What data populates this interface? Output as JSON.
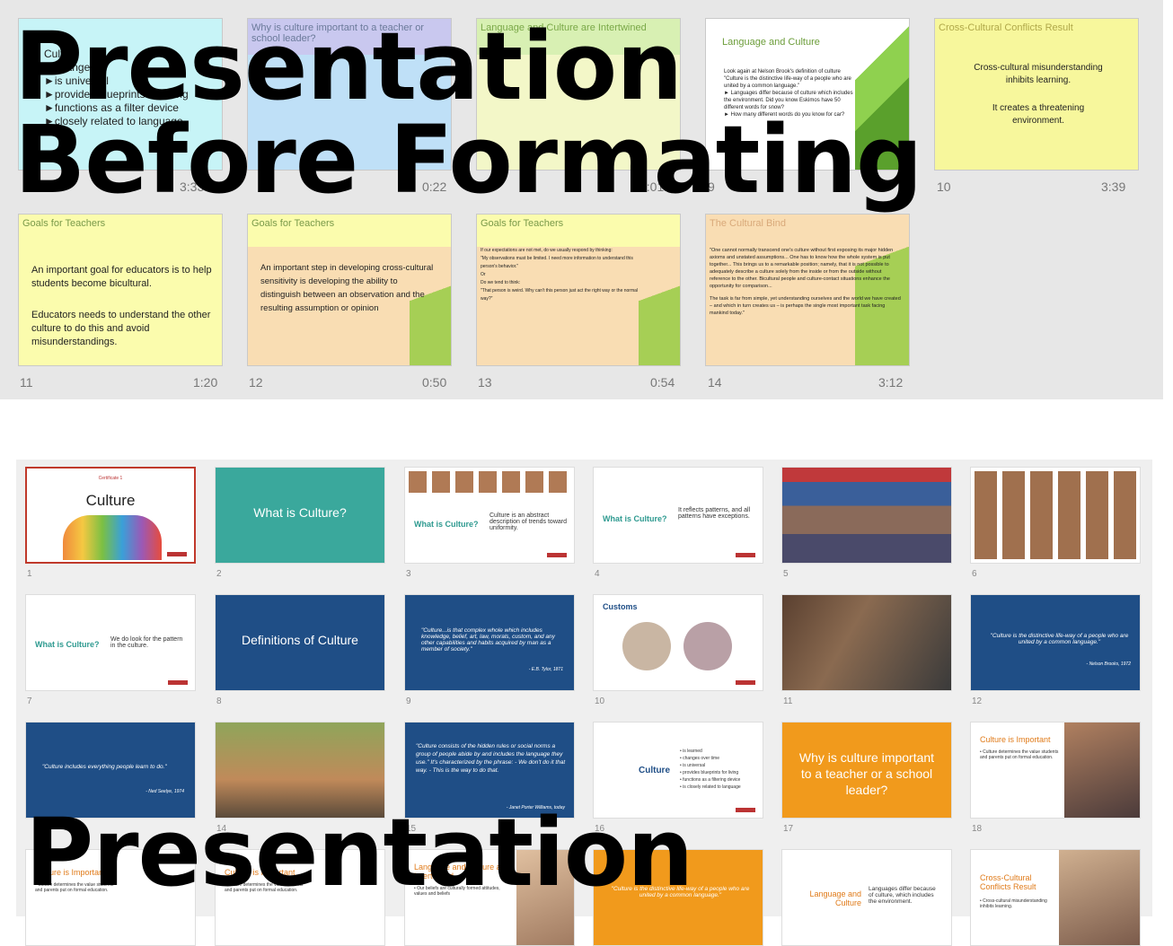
{
  "overlay": {
    "top_line1": "Presentation",
    "top_line2": "Before Formating",
    "bottom_line1": "Presentation"
  },
  "old_slides": [
    {
      "num": "",
      "time": "",
      "title": "",
      "lines": [
        "Culture",
        "►change",
        "►is universal",
        "►provides blueprints for living",
        "►functions as a filter device",
        "►closely related to language"
      ],
      "meta": "3:33"
    },
    {
      "num": "",
      "time": "",
      "title": "Why is culture important to a teacher or school leader?",
      "lines": [],
      "meta": "0:22"
    },
    {
      "num": "8",
      "time": "",
      "title": "Language and Culture are Intertwined",
      "lines": [],
      "meta": "0:01"
    },
    {
      "num": "9",
      "time": "",
      "title": "Language and Culture",
      "lines": [
        "Look again at Nelson Brook's definition of culture",
        "\"Culture is the distinctive life-way of a people who are united by a common language.\"",
        "► Languages differ because of culture which includes the environment. Did you know Eskimos have 50 different words for snow?",
        "► How many different words do you know for car?"
      ],
      "meta": ""
    },
    {
      "num": "10",
      "time": "3:39",
      "title": "Cross-Cultural Conflicts Result",
      "lines": [
        "Cross-cultural misunderstanding inhibits learning.",
        "It creates a threatening environment."
      ],
      "meta": ""
    },
    {
      "num": "11",
      "time": "1:20",
      "title": "Goals for Teachers",
      "lines": [
        "An important goal for educators is to help students become bicultural.",
        "Educators needs to understand the other culture to do this and avoid misunderstandings."
      ],
      "meta": ""
    },
    {
      "num": "12",
      "time": "0:50",
      "title": "Goals for Teachers",
      "lines": [
        "An important step in developing cross-cultural sensitivity is developing the ability to distinguish between an observation and the resulting assumption or opinion"
      ],
      "meta": ""
    },
    {
      "num": "13",
      "time": "0:54",
      "title": "Goals for Teachers",
      "lines": [
        "If our expectations are not met, do we usually respond by thinking:",
        "\"My observations must be limited. I need more information to understand this person's behavior.\"",
        "Or",
        "Do we tend to think:",
        "\"That person is weird. Why can't this person just act the right way or the normal way?\""
      ],
      "meta": ""
    },
    {
      "num": "14",
      "time": "3:12",
      "title": "The Cultural Bind",
      "lines": [
        "\"One cannot normally transcend one's culture without first exposing its major hidden axioms and unstated assumptions... One has to know how the whole system is put together... This brings us to a remarkable position; namely, that it is not possible to adequately describe a culture solely from the inside or from the outside without reference to the other. Bicultural people and culture-contact situations enhance the opportunity for comparison...",
        "The task is far from simple, yet understanding ourselves and the world we have created – and which in turn creates us – is perhaps the single most important task facing mankind today.\""
      ],
      "meta": ""
    }
  ],
  "new_slides": [
    {
      "num": "1",
      "title": "Culture",
      "sub": "Certificate 1",
      "kind": "hands"
    },
    {
      "num": "2",
      "title": "What is Culture?",
      "kind": "teal"
    },
    {
      "num": "3",
      "title": "What is Culture?",
      "body": "Culture is an abstract description of trends toward uniformity.",
      "kind": "white-faces"
    },
    {
      "num": "4",
      "title": "What is Culture?",
      "body": "It reflects patterns, and all patterns have exceptions.",
      "kind": "white"
    },
    {
      "num": "5",
      "title": "",
      "kind": "crowd"
    },
    {
      "num": "6",
      "title": "",
      "kind": "faces"
    },
    {
      "num": "7",
      "title": "What is Culture?",
      "body": "We do look for the pattern in the culture.",
      "kind": "white"
    },
    {
      "num": "8",
      "title": "Definitions of Culture",
      "kind": "navy"
    },
    {
      "num": "9",
      "title": "",
      "body": "\"Culture...is that complex whole which includes knowledge, belief, art, law, morals, custom, and any other capabilities and habits acquired by man as a member of society.\"",
      "attr": "- E.B. Tylor, 1871",
      "kind": "navy-quote"
    },
    {
      "num": "10",
      "title": "Customs",
      "kind": "customs"
    },
    {
      "num": "11",
      "title": "",
      "kind": "classroom"
    },
    {
      "num": "12",
      "title": "",
      "body": "\"Culture is the distinctive life-way of a people who are united by a common language.\"",
      "attr": "- Nelson Brooks, 1972",
      "kind": "navy-quote"
    },
    {
      "num": "",
      "title": "",
      "body": "\"Culture includes everything people learn to do.\"",
      "attr": "- Ned Seelye, 1974",
      "kind": "navy-quote"
    },
    {
      "num": "14",
      "title": "",
      "kind": "family"
    },
    {
      "num": "15",
      "title": "",
      "body": "\"Culture consists of the hidden rules or social norms a group of people abide by and includes the language they use.\" It's characterized by the phrase: - We don't do it that way. - This is the way to do that.",
      "attr": "- Janet Porter Williams, today",
      "kind": "navy-quote"
    },
    {
      "num": "16",
      "title": "Culture",
      "body": "• is learned\n• changes over time\n• is universal\n• provides blueprints for living\n• functions as a filtering device\n• is closely related to language",
      "kind": "white-list"
    },
    {
      "num": "17",
      "title": "Why is culture important to a teacher or a school leader?",
      "kind": "orange"
    },
    {
      "num": "18",
      "title": "Culture is Important",
      "body": "• Culture determines the value students and parents put on formal education.",
      "kind": "white-photo"
    }
  ],
  "row4": [
    {
      "title": "Culture is Important",
      "body": "• Culture determines the value students and parents put on formal education."
    },
    {
      "title": "Culture is Important",
      "body": "• Culture determines the value students and parents put on formal education."
    },
    {
      "title": "Language and Culture are Intertwined",
      "body": "• Our beliefs are culturally formed attitudes, values and beliefs"
    },
    {
      "title": "",
      "body": "\"Culture is the distinctive life-way of a people who are united by a common language.\""
    },
    {
      "title": "Language and Culture",
      "body": "Languages differ because of culture, which includes the environment."
    },
    {
      "title": "Cross-Cultural Conflicts Result",
      "body": "• Cross-cultural misunderstanding inhibits learning."
    }
  ]
}
